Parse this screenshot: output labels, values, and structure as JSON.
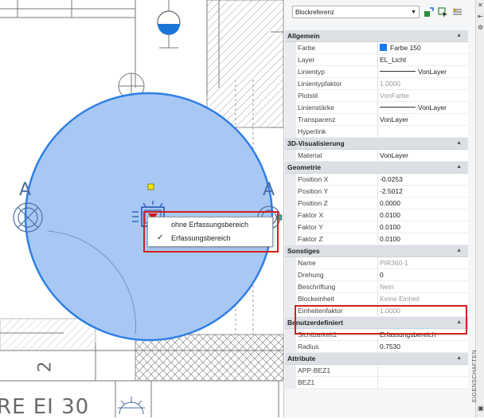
{
  "drawing": {
    "label_a_left": "A",
    "label_a_right": "A",
    "label_num": "2",
    "label_bottom": "RE  EI 30"
  },
  "context_menu": {
    "items": [
      {
        "label": "ohne Erfassungsbereich",
        "checked": false
      },
      {
        "label": "Erfassungsbereich",
        "checked": true
      }
    ],
    "check_glyph": "✓"
  },
  "properties": {
    "selector": "Blockreferenz",
    "panel_label": "EIGENSCHAFTEN",
    "categories": {
      "allgemein": "Allgemein",
      "visualisierung": "3D-Visualisierung",
      "geometrie": "Geometrie",
      "sonstiges": "Sonstiges",
      "benutzer": "Benutzerdefiniert",
      "attribute": "Attribute"
    },
    "allgemein": [
      {
        "name": "Farbe",
        "value": "Farbe 150"
      },
      {
        "name": "Layer",
        "value": "EL_Licht"
      },
      {
        "name": "Linientyp",
        "value": "VonLayer"
      },
      {
        "name": "Linientypfaktor",
        "value": "1.0000"
      },
      {
        "name": "Plotstil",
        "value": "VonFarbe"
      },
      {
        "name": "Linienstärke",
        "value": "VonLayer"
      },
      {
        "name": "Transparenz",
        "value": "VonLayer"
      },
      {
        "name": "Hyperlink",
        "value": ""
      }
    ],
    "visualisierung": [
      {
        "name": "Material",
        "value": "VonLayer"
      }
    ],
    "geometrie": [
      {
        "name": "Position X",
        "value": "-0.0253"
      },
      {
        "name": "Position Y",
        "value": "-2.5012"
      },
      {
        "name": "Position Z",
        "value": "0.0000"
      },
      {
        "name": "Faktor X",
        "value": "0.0100"
      },
      {
        "name": "Faktor Y",
        "value": "0.0100"
      },
      {
        "name": "Faktor Z",
        "value": "0.0100"
      }
    ],
    "sonstiges": [
      {
        "name": "Name",
        "value": "PIR360-1"
      },
      {
        "name": "Drehung",
        "value": "0"
      },
      {
        "name": "Beschriftung",
        "value": "Nein"
      },
      {
        "name": "Blockeinheit",
        "value": "Keine Einheit"
      },
      {
        "name": "Einheitenfaktor",
        "value": "1.0000"
      }
    ],
    "benutzer": [
      {
        "name": "Sichtbarkeit1",
        "value": "Erfassungsbereich"
      },
      {
        "name": "Radius",
        "value": "0.7530"
      }
    ],
    "attribute": [
      {
        "name": "APP-BEZ1",
        "value": ""
      },
      {
        "name": "BEZ1",
        "value": ""
      }
    ]
  },
  "colors": {
    "detection_fill": "#a8c8f4",
    "detection_stroke": "#2f7ee6",
    "highlight": "#d42020",
    "color_swatch": "#1a7ae6"
  }
}
